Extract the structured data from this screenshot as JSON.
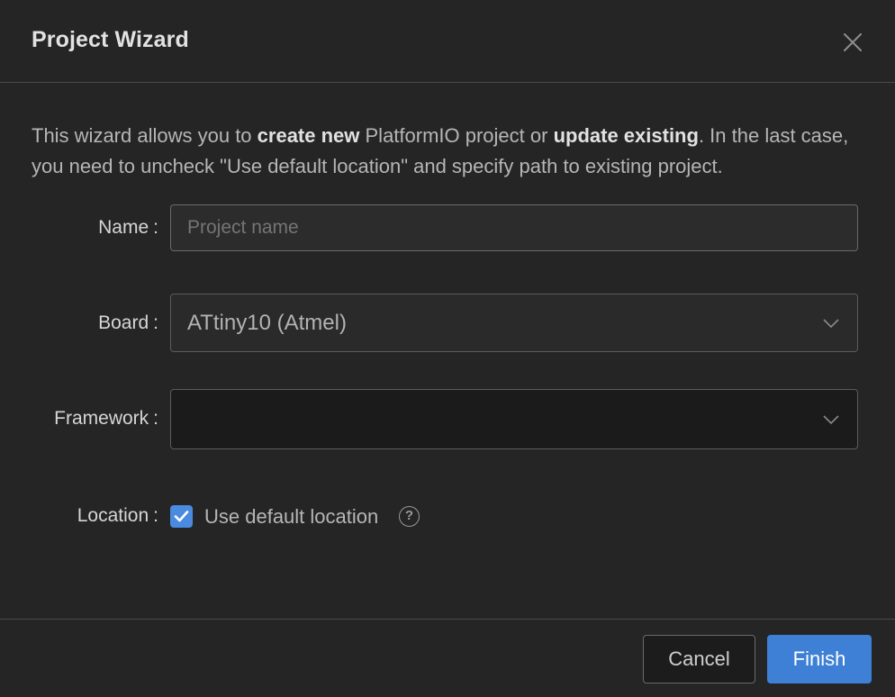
{
  "dialog": {
    "title": "Project Wizard"
  },
  "description": {
    "part1": "This wizard allows you to ",
    "bold1": "create new",
    "part2": " PlatformIO project or ",
    "bold2": "update existing",
    "part3": ". In the last case, you need to uncheck \"Use default location\" and specify path to existing project."
  },
  "form": {
    "name_label": "Name",
    "name_placeholder": "Project name",
    "name_value": "",
    "board_label": "Board",
    "board_value": "ATtiny10 (Atmel)",
    "framework_label": "Framework",
    "framework_value": "",
    "location_label": "Location",
    "location_checkbox_label": "Use default location",
    "location_checked": true,
    "help_glyph": "?",
    "colon": ":"
  },
  "icons": {
    "close": "close-icon",
    "chevron": "chevron-down-icon",
    "check": "checkmark-icon",
    "help": "question-circle-icon"
  },
  "colors": {
    "accent": "#3d80d6",
    "background": "#252526"
  },
  "buttons": {
    "cancel": "Cancel",
    "finish": "Finish"
  }
}
